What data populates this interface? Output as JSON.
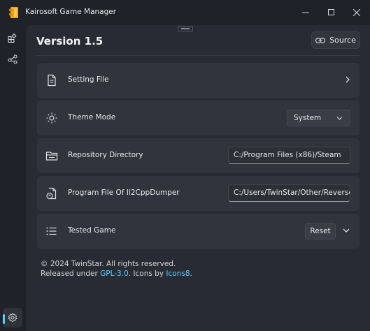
{
  "window": {
    "title": "Kairosoft Game Manager",
    "minimize_icon": "minimize-icon",
    "maximize_icon": "maximize-icon",
    "close_icon": "close-icon"
  },
  "nav": {
    "items": [
      {
        "name": "home",
        "icon": "grid-icon"
      },
      {
        "name": "share",
        "icon": "share-nodes-icon"
      }
    ],
    "settings": {
      "icon": "gear-icon",
      "active": true
    },
    "accent": "#60cdff"
  },
  "header": {
    "title": "Version 1.5",
    "source_label": "Source",
    "source_icon": "link-icon"
  },
  "settings": {
    "setting_file": {
      "label": "Setting File",
      "icon": "document-icon"
    },
    "theme_mode": {
      "label": "Theme Mode",
      "icon": "sun-icon",
      "value": "System"
    },
    "repo_dir": {
      "label": "Repository Directory",
      "icon": "folder-icon",
      "value": "C:/Program Files (x86)/Steam"
    },
    "program_file": {
      "label": "Program File Of Il2CppDumper",
      "icon": "file-sync-icon",
      "value": "C:/Users/TwinStar/Other/Reverse/Il"
    },
    "tested_game": {
      "label": "Tested Game",
      "icon": "list-icon",
      "reset_label": "Reset"
    }
  },
  "footer": {
    "copyright": "© 2024 TwinStar. All rights reserved.",
    "released_prefix": "Released under ",
    "license": "GPL-3.0",
    "icons_by": ". Icons by ",
    "icons_source": "Icons8",
    "end": "."
  }
}
